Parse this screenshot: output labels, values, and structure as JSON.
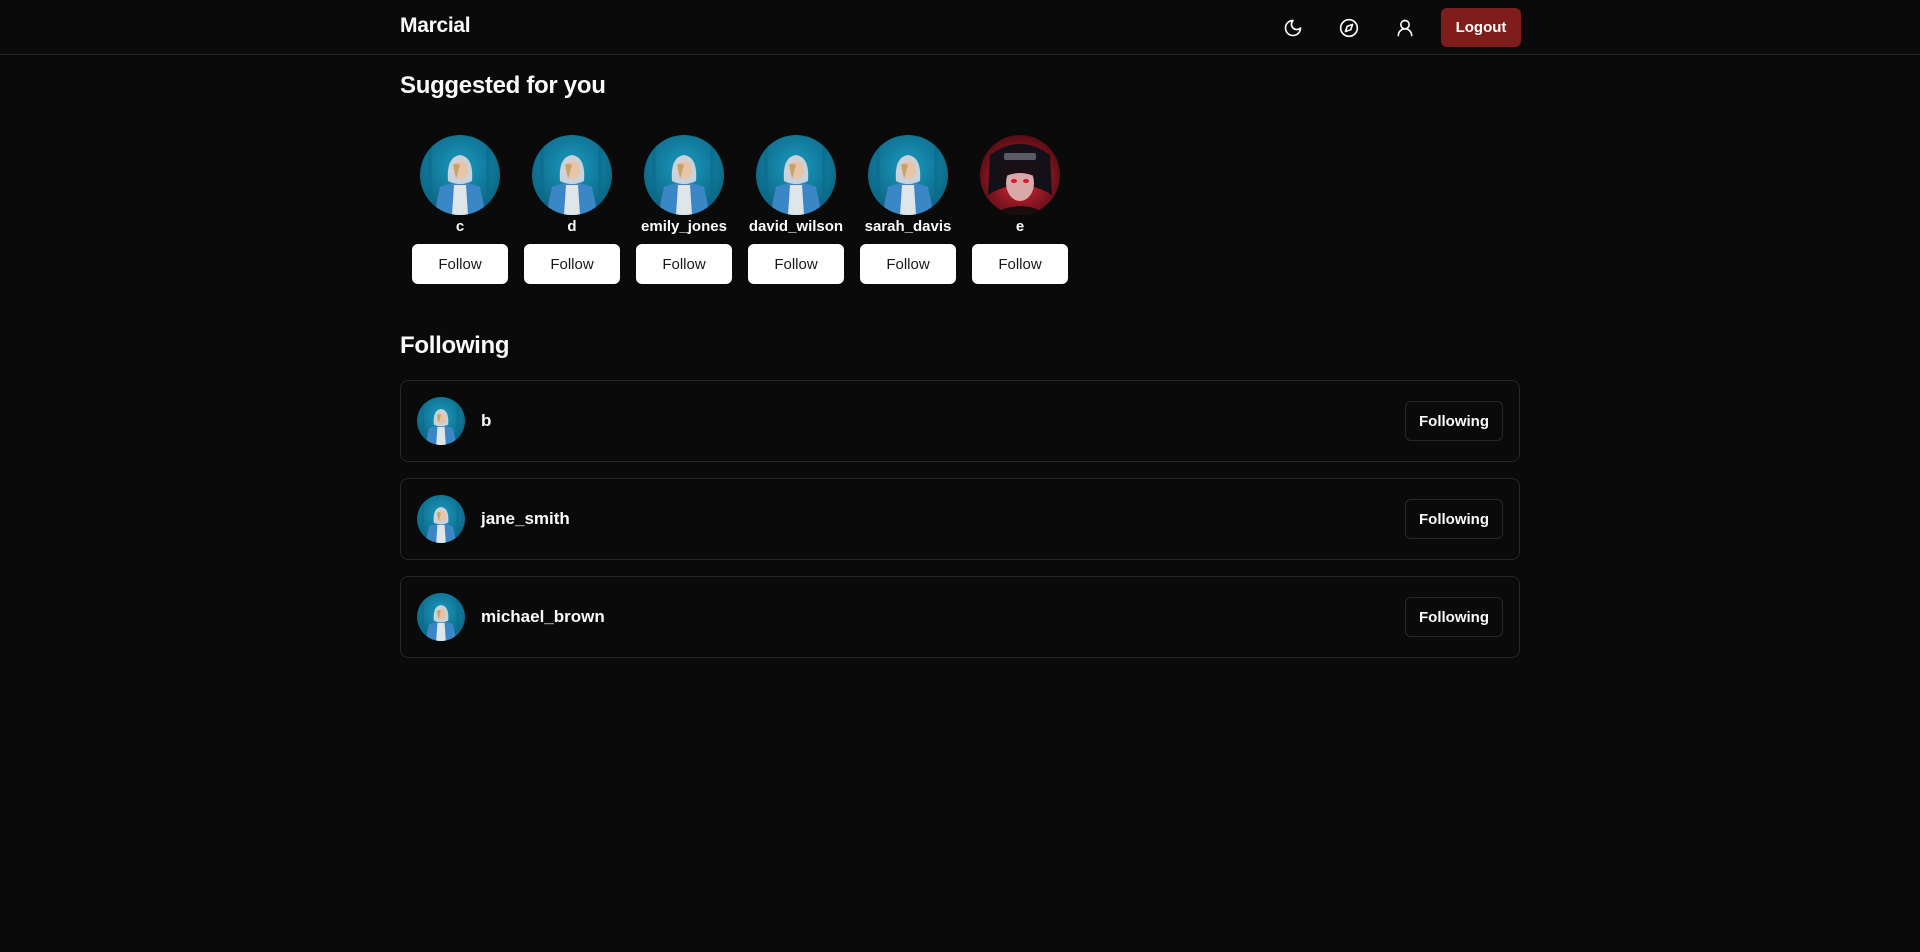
{
  "header": {
    "brand": "Marcial",
    "icons": [
      "moon-icon",
      "compass-icon",
      "user-icon"
    ],
    "logout_label": "Logout"
  },
  "suggested": {
    "title": "Suggested for you",
    "follow_label": "Follow",
    "users": [
      {
        "name": "c",
        "avatar": "blue-hoodie-person"
      },
      {
        "name": "d",
        "avatar": "blue-hoodie-person"
      },
      {
        "name": "emily_jones",
        "avatar": "blue-hoodie-person"
      },
      {
        "name": "david_wilson",
        "avatar": "blue-hoodie-person"
      },
      {
        "name": "sarah_davis",
        "avatar": "blue-hoodie-person"
      },
      {
        "name": "e",
        "avatar": "red-anime-character"
      }
    ]
  },
  "following": {
    "title": "Following",
    "button_label": "Following",
    "users": [
      {
        "name": "b"
      },
      {
        "name": "jane_smith"
      },
      {
        "name": "michael_brown"
      }
    ]
  },
  "colors": {
    "background": "#0a0a0b",
    "border": "#27272a",
    "logout": "#7f1d1d",
    "avatar_blue": "#0f7fa0",
    "avatar_red": "#c41e2a"
  }
}
